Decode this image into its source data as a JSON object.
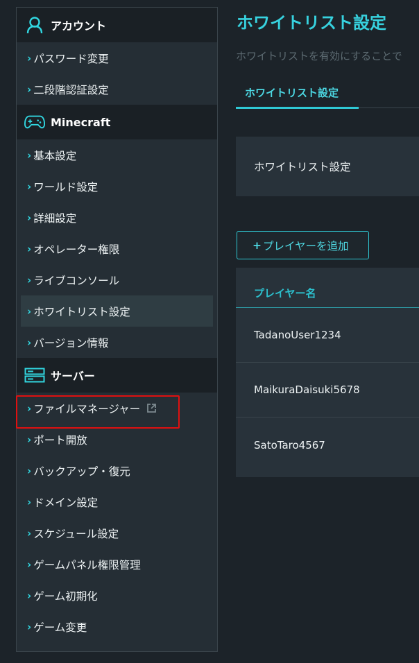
{
  "sidebar": {
    "sections": [
      {
        "title": "アカウント",
        "icon": "user-icon",
        "items": [
          "パスワード変更",
          "二段階認証設定"
        ]
      },
      {
        "title": "Minecraft",
        "icon": "gamepad-icon",
        "items": [
          "基本設定",
          "ワールド設定",
          "詳細設定",
          "オペレーター権限",
          "ライブコンソール",
          "ホワイトリスト設定",
          "バージョン情報"
        ]
      },
      {
        "title": "サーバー",
        "icon": "server-icon",
        "items": [
          "ファイルマネージャー",
          "ポート開放",
          "バックアップ・復元",
          "ドメイン設定",
          "スケジュール設定",
          "ゲームパネル権限管理",
          "ゲーム初期化",
          "ゲーム変更"
        ]
      }
    ]
  },
  "main": {
    "title": "ホワイトリスト設定",
    "description": "ホワイトリストを有効にすることで",
    "tab_label": "ホワイトリスト設定",
    "panel_label": "ホワイトリスト設定",
    "add_button": {
      "plus": "+",
      "label": "プレイヤーを追加"
    },
    "table": {
      "header": "プレイヤー名",
      "rows": [
        "TadanoUser1234",
        "MaikuraDaisuki5678",
        "SatoTaro4567"
      ]
    }
  },
  "colors": {
    "accent": "#37d2df",
    "highlight": "#e01010",
    "sidebar_bg": "#252e35",
    "page_bg": "#1c2329"
  }
}
